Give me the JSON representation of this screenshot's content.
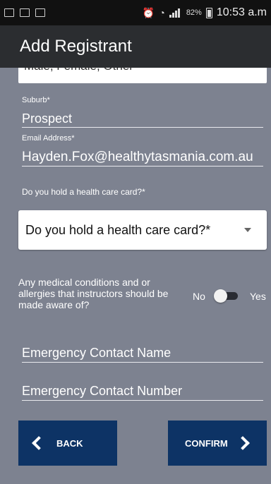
{
  "status_bar": {
    "battery_percent": "82%",
    "time": "10:53 a.m"
  },
  "app_bar": {
    "title": "Add Registrant"
  },
  "form": {
    "gender_partial": "Male, Female, Other",
    "suburb_label": "Suburb*",
    "suburb_value": "Prospect",
    "email_label": "Email Address*",
    "email_value": "Hayden.Fox@healthytasmania.com.au",
    "health_card_question": "Do you hold a health care card?*",
    "health_card_select": "Do you hold a health care card?*",
    "medical_question": "Any medical conditions and or allergies that instructors should be made aware of?",
    "toggle_no": "No",
    "toggle_yes": "Yes",
    "emergency_name_placeholder": "Emergency Contact Name",
    "emergency_number_placeholder": "Emergency Contact Number"
  },
  "buttons": {
    "back": "BACK",
    "confirm": "CONFIRM"
  }
}
